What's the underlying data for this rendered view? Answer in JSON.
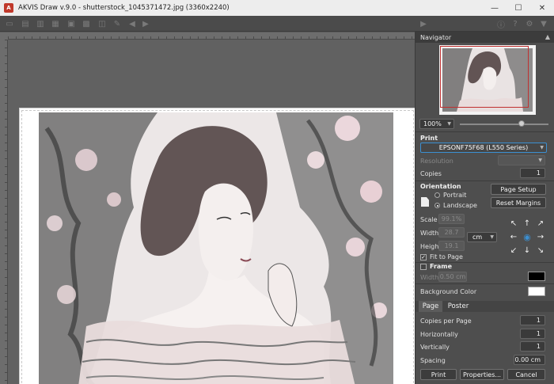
{
  "window": {
    "title": "AKVIS Draw v.9.0 - shutterstock_1045371472.jpg (3360x2240)",
    "logo_text": "A",
    "controls": {
      "minimize": "—",
      "maximize": "☐",
      "close": "✕"
    }
  },
  "toolbar": {
    "icons": [
      "open-file-icon",
      "save-file-icon",
      "export-icon",
      "print-icon",
      "share-icon",
      "batch-icon",
      "effect-icon",
      "edit-icon",
      "undo-icon",
      "redo-icon",
      "run-icon",
      "info-icon",
      "help-icon",
      "settings-icon",
      "news-icon"
    ]
  },
  "navigator": {
    "title": "Navigator",
    "zoom": "100%",
    "zoom_slider_fraction": 0.7
  },
  "print": {
    "section_title": "Print",
    "printer": "EPSONF75F68 (L550 Series)",
    "resolution_label": "Resolution",
    "copies_label": "Copies",
    "copies": "1",
    "orientation_title": "Orientation",
    "portrait_label": "Portrait",
    "landscape_label": "Landscape",
    "page_setup_label": "Page Setup",
    "reset_margins_label": "Reset Margins",
    "scale_label": "Scale",
    "scale_value": "99.1%",
    "width_label": "Width",
    "width_value": "28.7",
    "height_label": "Height",
    "height_value": "19.1",
    "unit": "cm",
    "fit_to_page_label": "Fit to Page",
    "fit_to_page_checked": true,
    "frame_label": "Frame",
    "frame_checked": false,
    "frame_width_label": "Width",
    "frame_width_value": "0.50 cm",
    "frame_color": "#000000",
    "background_color_label": "Background Color",
    "background_color": "#ffffff"
  },
  "page_tabs": {
    "page_label": "Page",
    "poster_label": "Poster",
    "copies_per_page_label": "Copies per Page",
    "copies_per_page": "1",
    "horizontally_label": "Horizontally",
    "horizontally": "1",
    "vertically_label": "Vertically",
    "vertically": "1",
    "spacing_label": "Spacing",
    "spacing": "0.00 cm"
  },
  "buttons": {
    "print": "Print",
    "properties": "Properties...",
    "cancel": "Cancel"
  }
}
